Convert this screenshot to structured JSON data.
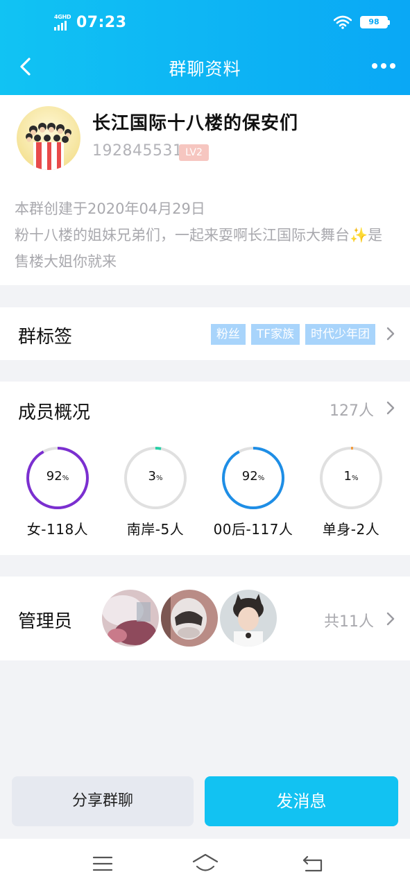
{
  "status_bar": {
    "network": "4GHD",
    "time": "07:23",
    "battery": "98"
  },
  "nav": {
    "title": "群聊资料"
  },
  "group": {
    "name": "长江国际十八楼的保安们",
    "id": "192845531",
    "level": "LV2",
    "created": "本群创建于2020年04月29日",
    "description": "粉十八楼的姐妹兄弟们，一起来耍啊长江国际大舞台✨是售楼大姐你就来"
  },
  "tags_section": {
    "label": "群标签",
    "tags": [
      "粉丝",
      "TF家族",
      "时代少年团"
    ]
  },
  "members_section": {
    "label": "成员概况",
    "count": "127人",
    "stats": [
      {
        "percent": 92,
        "percent_text": "92",
        "unit": "%",
        "label": "女-118人",
        "color": "#7b2fd0"
      },
      {
        "percent": 3,
        "percent_text": "3",
        "unit": "%",
        "label": "南岸-5人",
        "color": "#27cfa6"
      },
      {
        "percent": 92,
        "percent_text": "92",
        "unit": "%",
        "label": "00后-117人",
        "color": "#1e8ee6"
      },
      {
        "percent": 1,
        "percent_text": "1",
        "unit": "%",
        "label": "单身-2人",
        "color": "#f39a3b"
      }
    ]
  },
  "admins_section": {
    "label": "管理员",
    "count": "共11人"
  },
  "actions": {
    "share": "分享群聊",
    "message": "发消息"
  }
}
